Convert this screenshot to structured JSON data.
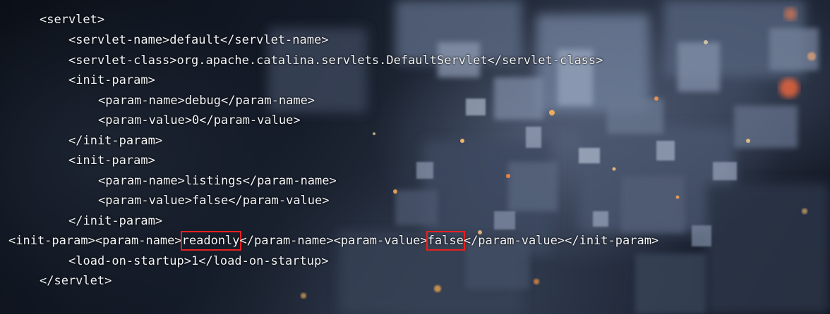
{
  "code_lines": [
    "<servlet>",
    "<servlet-name>default</servlet-name>",
    "<servlet-class>org.apache.catalina.servlets.DefaultServlet</servlet-class>",
    "<init-param>",
    "<param-name>debug</param-name>",
    "<param-value>0</param-value>",
    "</init-param>",
    "<init-param>",
    "<param-name>listings</param-name>",
    "<param-value>false</param-value>",
    "</init-param>",
    "",
    "<load-on-startup>1</load-on-startup>",
    "</servlet>"
  ],
  "inserted_line": {
    "before_name": "<init-param><param-name>",
    "name": "readonly",
    "middle": "</param-name><param-value>",
    "value": "false",
    "after_value": "</param-value></init-param>"
  },
  "colors": {
    "text": "#f4f6f9",
    "highlight_box": "#e8201f"
  },
  "background": "blurred-3d-city-blocks-image"
}
